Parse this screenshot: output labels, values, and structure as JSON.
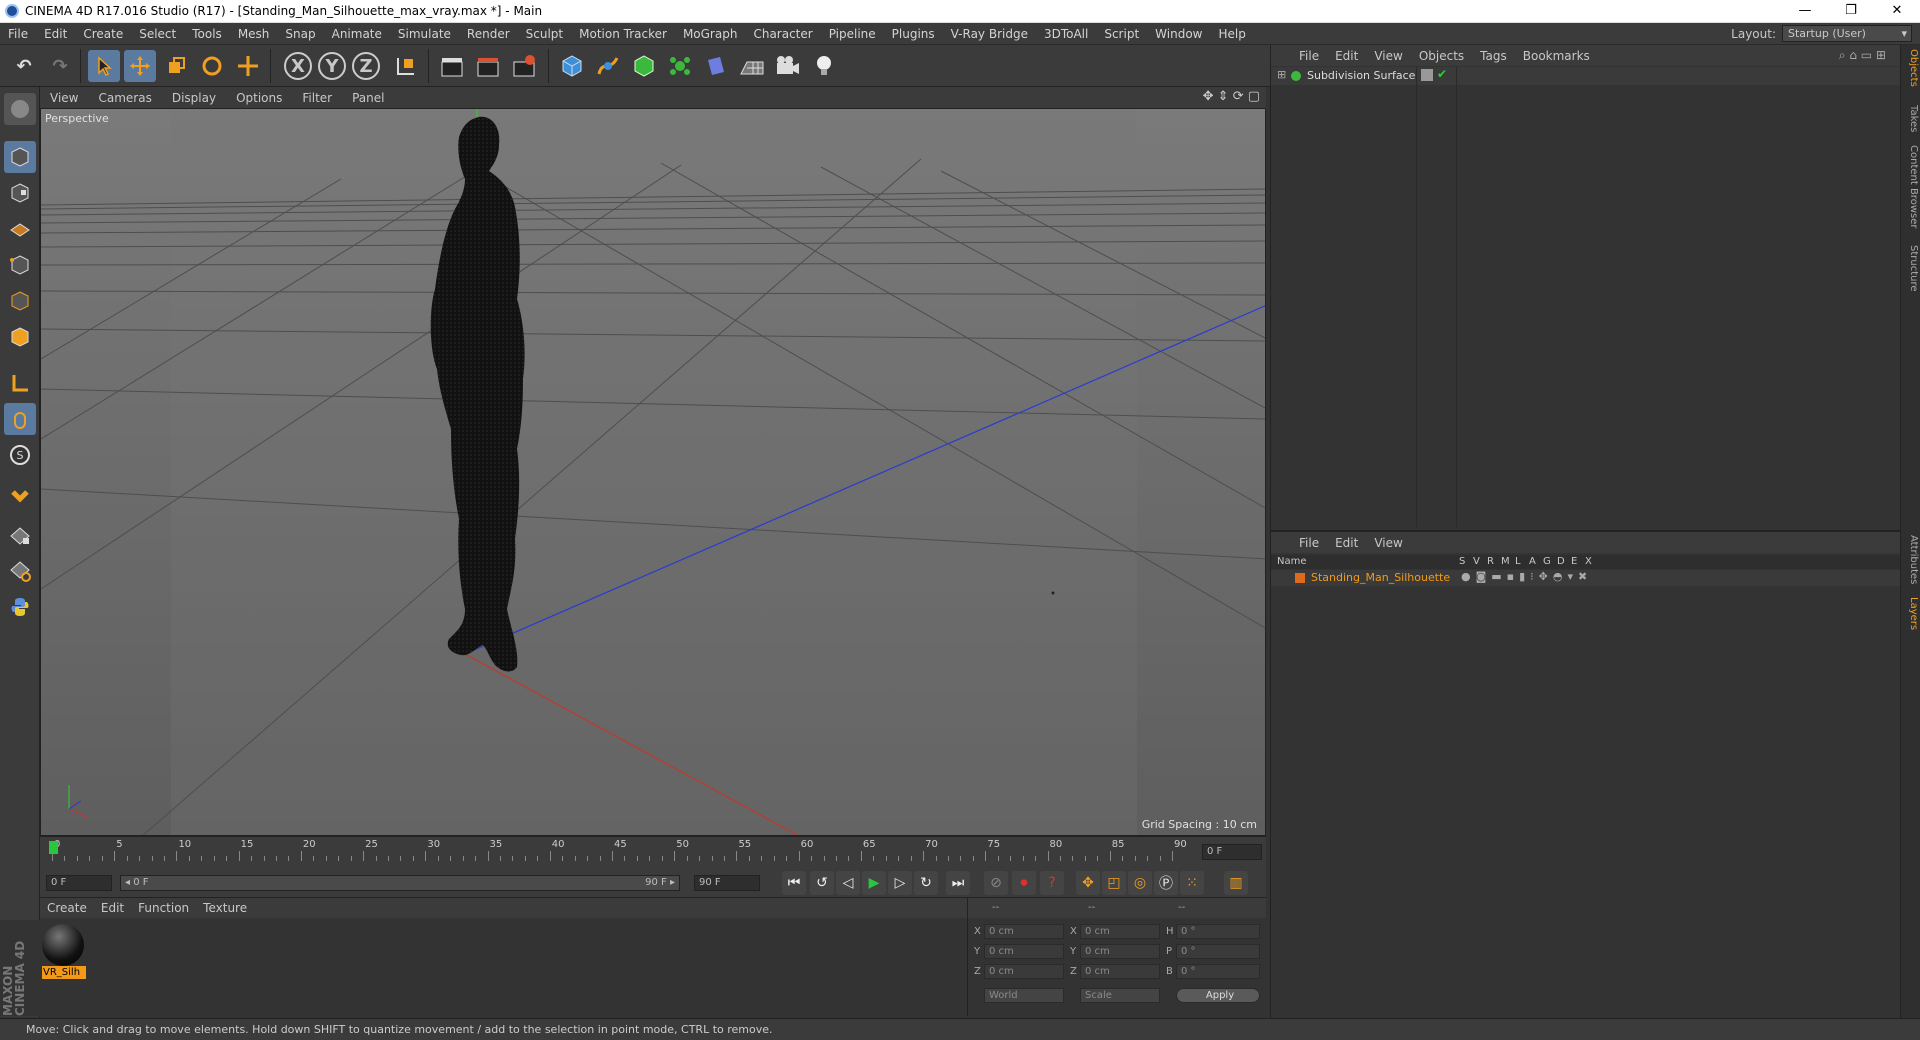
{
  "window": {
    "title": "CINEMA 4D R17.016 Studio (R17) - [Standing_Man_Silhouette_max_vray.max *] - Main",
    "minimize": "—",
    "maximize": "❐",
    "close": "✕"
  },
  "menubar": [
    "File",
    "Edit",
    "Create",
    "Select",
    "Tools",
    "Mesh",
    "Snap",
    "Animate",
    "Simulate",
    "Render",
    "Sculpt",
    "Motion Tracker",
    "MoGraph",
    "Character",
    "Pipeline",
    "Plugins",
    "V-Ray Bridge",
    "3DToAll",
    "Script",
    "Window",
    "Help"
  ],
  "layout": {
    "label": "Layout:",
    "value": "Startup (User)"
  },
  "toolbar": {
    "undo": "↶",
    "redo": "↷",
    "x_axis": "X",
    "y_axis": "Y",
    "z_axis": "Z"
  },
  "viewport": {
    "menu": [
      "View",
      "Cameras",
      "Display",
      "Options",
      "Filter",
      "Panel"
    ],
    "camera_label": "Perspective",
    "grid_spacing": "Grid Spacing : 10 cm",
    "axis_x_color": "#c0392b",
    "axis_z_color": "#2b3bd0"
  },
  "timeline": {
    "ticks": [
      "0",
      "5",
      "10",
      "15",
      "20",
      "25",
      "30",
      "35",
      "40",
      "45",
      "50",
      "55",
      "60",
      "65",
      "70",
      "75",
      "80",
      "85",
      "90"
    ],
    "current_frame_field": "0 F",
    "start_field": "0 F",
    "range_start": "◂ 0 F",
    "range_end": "90 F ▸",
    "end_field": "90 F",
    "end_field2": "90 F"
  },
  "materials": {
    "menu": [
      "Create",
      "Edit",
      "Function",
      "Texture"
    ],
    "items": [
      {
        "label": "VR_Silh"
      }
    ]
  },
  "coordinates": {
    "header": [
      "--",
      "--",
      "--"
    ],
    "rows": [
      {
        "a": "X",
        "av": "0 cm",
        "b": "X",
        "bv": "0 cm",
        "c": "H",
        "cv": "0 °"
      },
      {
        "a": "Y",
        "av": "0 cm",
        "b": "Y",
        "bv": "0 cm",
        "c": "P",
        "cv": "0 °"
      },
      {
        "a": "Z",
        "av": "0 cm",
        "b": "Z",
        "bv": "0 cm",
        "c": "B",
        "cv": "0 °"
      }
    ],
    "world": "World",
    "scale": "Scale",
    "apply": "Apply"
  },
  "objects": {
    "menu": [
      "File",
      "Edit",
      "View",
      "Objects",
      "Tags",
      "Bookmarks"
    ],
    "items": [
      {
        "name": "Subdivision Surface"
      }
    ]
  },
  "layers": {
    "menu": [
      "File",
      "Edit",
      "View"
    ],
    "header": {
      "name": "Name",
      "flags": [
        "S",
        "V",
        "R",
        "M",
        "L",
        "A",
        "G",
        "D",
        "E",
        "X"
      ]
    },
    "items": [
      {
        "name": "Standing_Man_Silhouette",
        "color": "#e06a1c"
      }
    ]
  },
  "side_tabs": [
    "Objects",
    "Takes",
    "Content Browser",
    "Structure",
    "Attributes",
    "Layers"
  ],
  "status": "Move: Click and drag to move elements. Hold down SHIFT to quantize movement / add to the selection in point mode, CTRL to remove.",
  "brand": "MAXON CINEMA 4D"
}
